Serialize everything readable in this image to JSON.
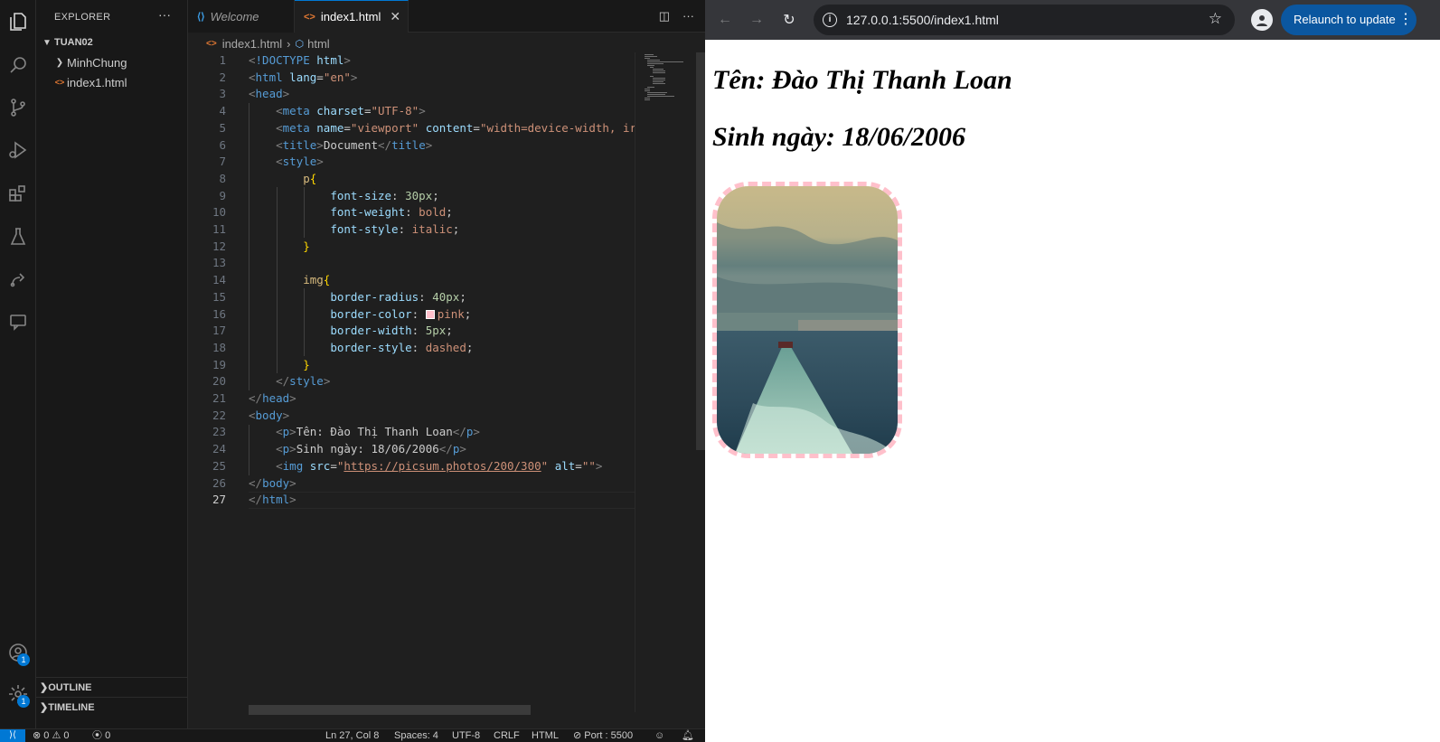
{
  "vscode": {
    "explorer_title": "EXPLORER",
    "more_label": "···",
    "folder_name": "TUAN02",
    "tree": [
      {
        "label": "MinhChung",
        "kind": "folder"
      },
      {
        "label": "index1.html",
        "kind": "file"
      }
    ],
    "outline_label": "OUTLINE",
    "timeline_label": "TIMELINE",
    "accounts_badge": "1",
    "settings_badge": "1",
    "tabs": [
      {
        "label": "Welcome",
        "icon": "vscode-logo-icon"
      },
      {
        "label": "index1.html",
        "icon": "html-file-icon",
        "close": "✕"
      }
    ],
    "breadcrumb": {
      "file": "index1.html",
      "symbol": "html"
    },
    "code_lines": [
      "1",
      "2",
      "3",
      "4",
      "5",
      "6",
      "7",
      "8",
      "9",
      "10",
      "11",
      "12",
      "13",
      "14",
      "15",
      "16",
      "17",
      "18",
      "19",
      "20",
      "21",
      "22",
      "23",
      "24",
      "25",
      "26",
      "27"
    ],
    "code": {
      "doctype": "!DOCTYPE",
      "html": "html",
      "lang_attr": "lang",
      "lang_val": "\"en\"",
      "head": "head",
      "meta": "meta",
      "charset_attr": "charset",
      "charset_val": "\"UTF-8\"",
      "name_attr": "name",
      "name_val": "\"viewport\"",
      "content_attr": "content",
      "content_val": "\"width=device-width, ir",
      "title": "title",
      "title_text": "Document",
      "style": "style",
      "p_sel": "p",
      "font_size": "font-size",
      "font_size_val": "30px",
      "font_weight": "font-weight",
      "font_weight_val": "bold",
      "font_style": "font-style",
      "font_style_val": "italic",
      "img_sel": "img",
      "border_radius": "border-radius",
      "border_radius_val": "40px",
      "border_color": "border-color",
      "border_color_val": "pink",
      "border_width": "border-width",
      "border_width_val": "5px",
      "border_style": "border-style",
      "border_style_val": "dashed",
      "body": "body",
      "p": "p",
      "p1_text": "Tên: Đào Thị Thanh Loan",
      "p2_text": "Sinh ngày: 18/06/2006",
      "img": "img",
      "src_attr": "src",
      "src_val": "https://picsum.photos/200/300",
      "alt_attr": "alt",
      "alt_val": "\"\""
    },
    "status": {
      "errors": "0",
      "warnings": "0",
      "ports": "0",
      "position": "Ln 27, Col 8",
      "spaces": "Spaces: 4",
      "encoding": "UTF-8",
      "eol": "CRLF",
      "language": "HTML",
      "port": "Port : 5500"
    }
  },
  "browser": {
    "url": "127.0.0.1:5500/index1.html",
    "relaunch_label": "Relaunch to update",
    "page": {
      "line1": "Tên: Đào Thị Thanh Loan",
      "line2": "Sinh ngày: 18/06/2006"
    }
  },
  "colors": {
    "accent": "#0078d4",
    "img_border": "#ffc0cb",
    "relaunch_bg": "#0b57a0"
  }
}
